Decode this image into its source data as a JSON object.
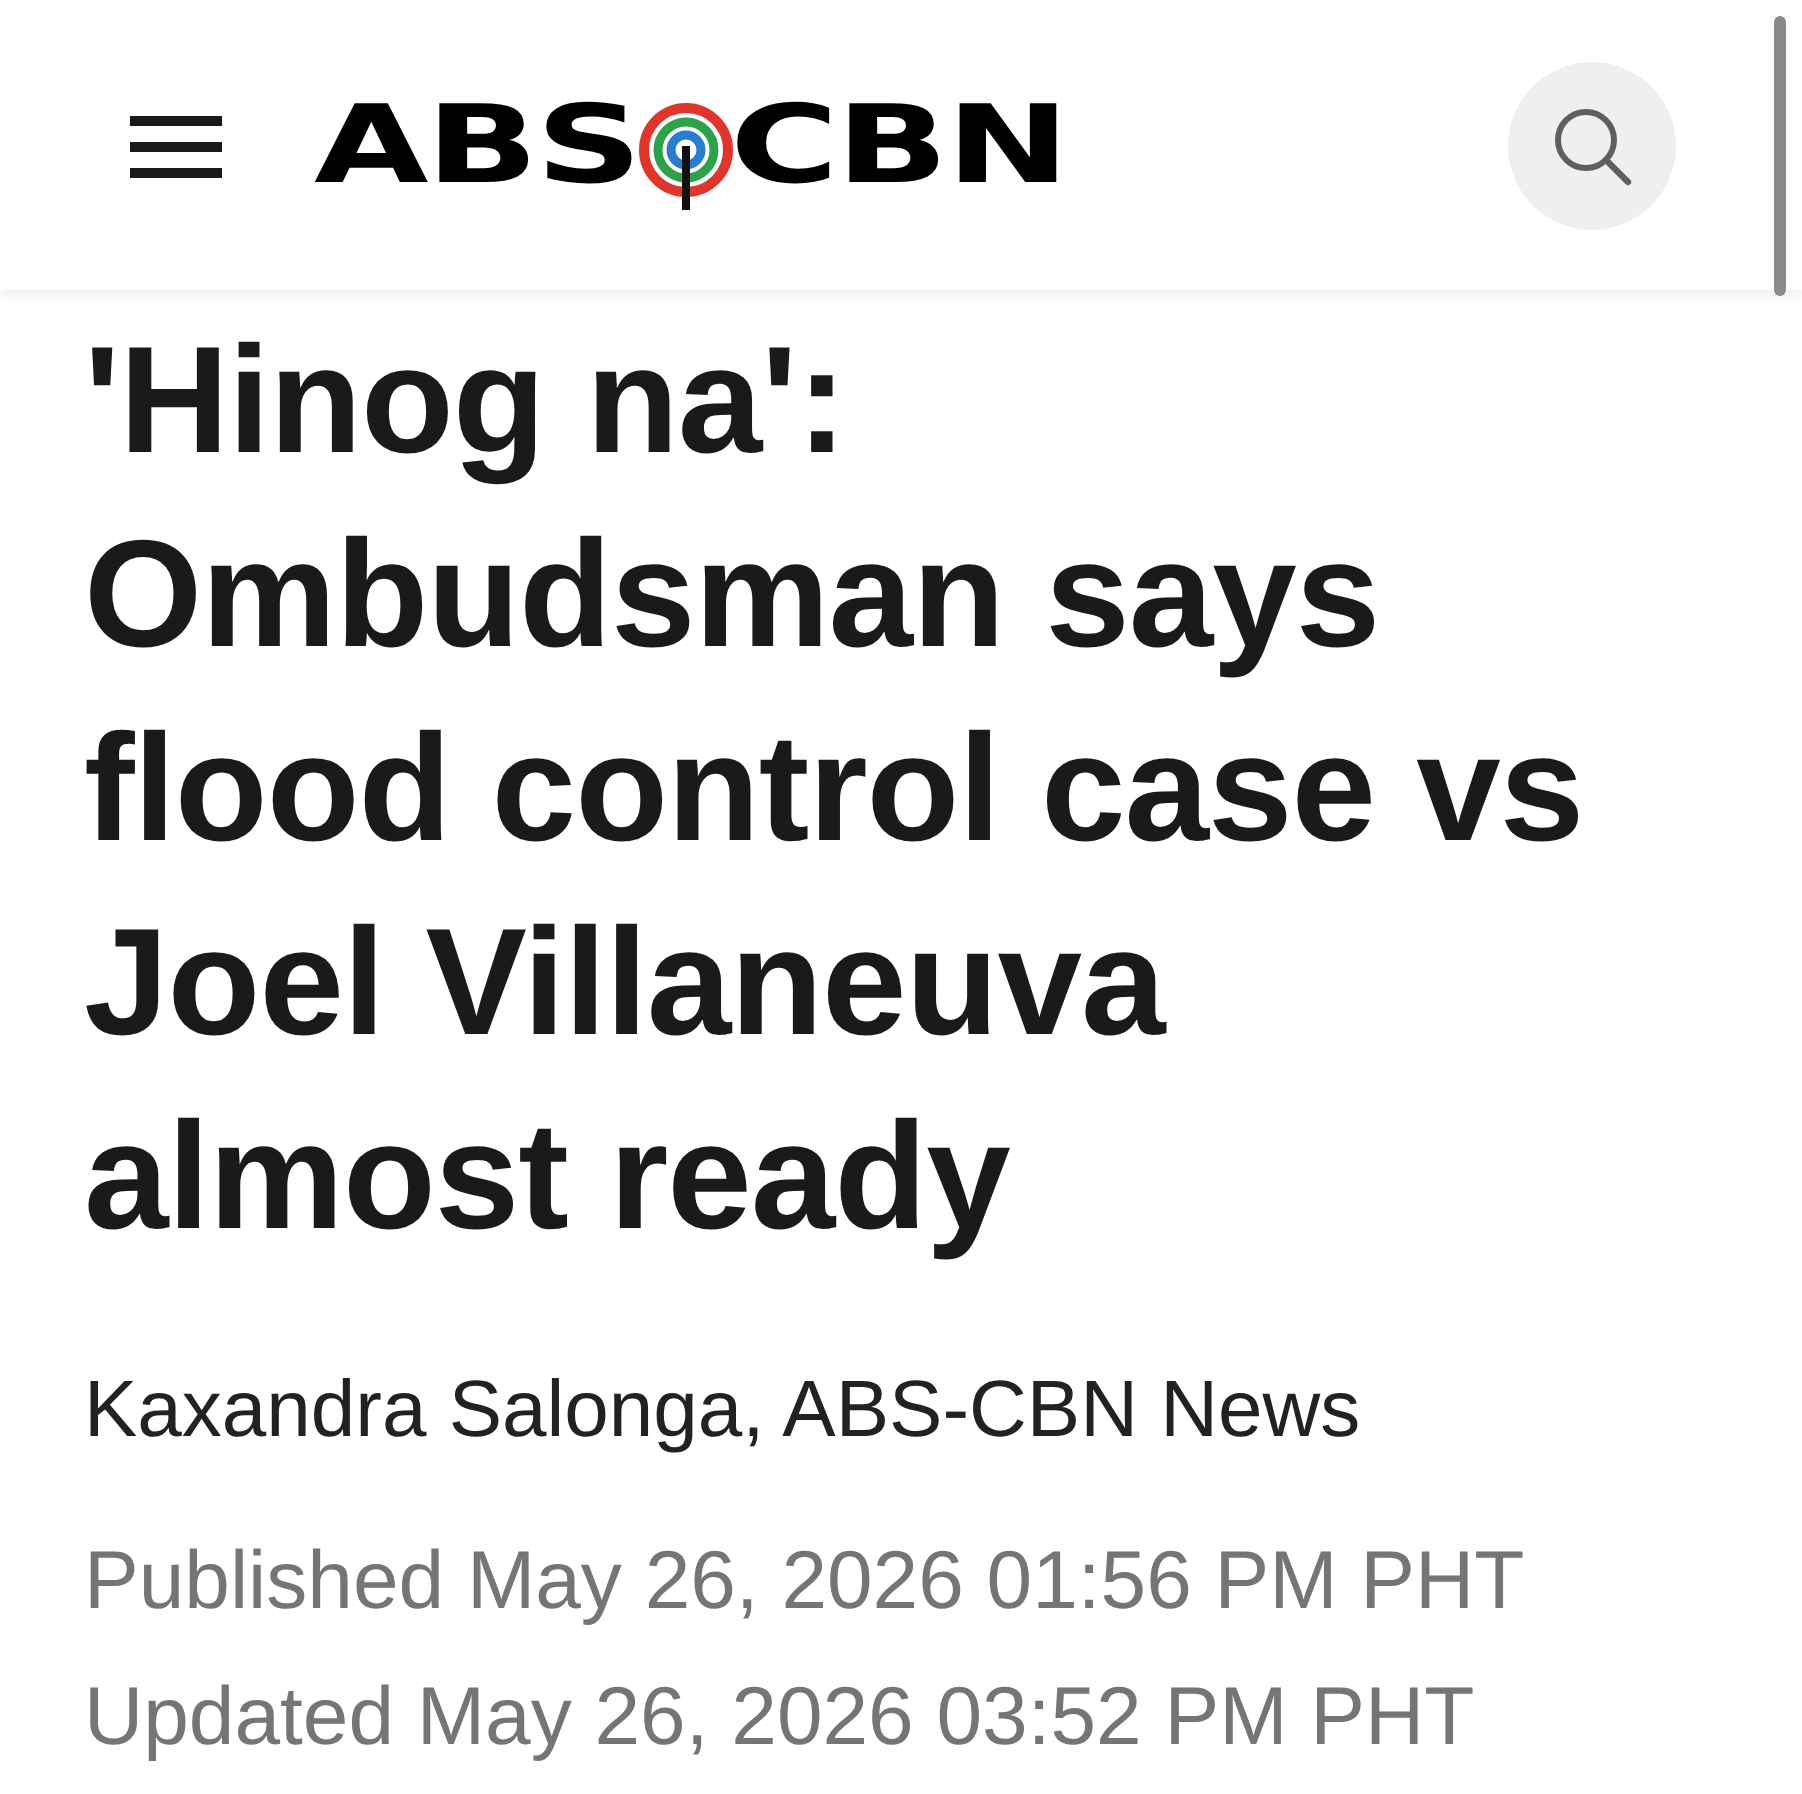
{
  "header": {
    "logo": {
      "left": "ABS",
      "right": "CBN"
    }
  },
  "article": {
    "headline": "'Hinog na': Ombudsman says flood control case vs Joel Villaneuva almost ready",
    "byline": "Kaxandra Salonga, ABS-CBN News",
    "published": "Published May 26, 2026 01:56 PM PHT",
    "updated": "Updated May 26, 2026 03:52 PM PHT"
  }
}
